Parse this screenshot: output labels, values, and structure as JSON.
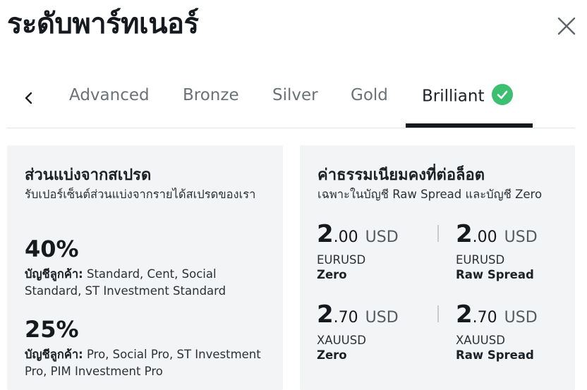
{
  "header": {
    "title": "ระดับพาร์ทเนอร์"
  },
  "tabs": {
    "items": [
      {
        "label": "Advanced"
      },
      {
        "label": "Bronze"
      },
      {
        "label": "Silver"
      },
      {
        "label": "Gold"
      },
      {
        "label": "Brilliant"
      }
    ],
    "active": "Brilliant"
  },
  "spread_share": {
    "title": "ส่วนแบ่งจากสเปรด",
    "subtitle": "รับเปอร์เซ็นต์ส่วนแบ่งจากรายได้สเปรดของเรา",
    "tiers": [
      {
        "percent": "40%",
        "accounts_label": "บัญชีลูกค้า:",
        "accounts": "Standard, Cent, Social Standard, ST Investment Standard"
      },
      {
        "percent": "25%",
        "accounts_label": "บัญชีลูกค้า:",
        "accounts": "Pro, Social Pro, ST Investment Pro, PIM Investment Pro"
      }
    ]
  },
  "fixed_fee": {
    "title": "ค่าธรรมเนียมคงที่ต่อล็อต",
    "subtitle": "เฉพาะในบัญชี Raw Spread และบัญชี Zero",
    "fees": [
      {
        "int": "2",
        "dec": ".00",
        "currency": "USD",
        "symbol": "EURUSD",
        "account": "Zero"
      },
      {
        "int": "2",
        "dec": ".00",
        "currency": "USD",
        "symbol": "EURUSD",
        "account": "Raw Spread"
      },
      {
        "int": "2",
        "dec": ".70",
        "currency": "USD",
        "symbol": "XAUUSD",
        "account": "Zero"
      },
      {
        "int": "2",
        "dec": ".70",
        "currency": "USD",
        "symbol": "XAUUSD",
        "account": "Raw Spread"
      }
    ]
  },
  "colors": {
    "accent_check": "#3cbf71",
    "card_bg": "#f3f4f5",
    "text": "#1c2126"
  },
  "icons": {
    "close": "close-icon",
    "prev": "chevron-left-icon",
    "check": "check-circle-icon"
  }
}
